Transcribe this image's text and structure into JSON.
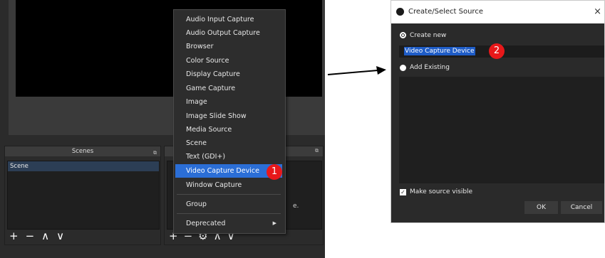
{
  "obs": {
    "scenes_dock": {
      "title": "Scenes",
      "float_icon": "⧉",
      "items": [
        "Scene"
      ],
      "tools": [
        "+",
        "−",
        "∧",
        "∨"
      ]
    },
    "sources_dock": {
      "float_icon": "⧉",
      "hint_fragment": "e.",
      "tools": [
        "+",
        "−",
        "⚙",
        "∧",
        "∨"
      ]
    }
  },
  "context_menu": {
    "items": [
      "Audio Input Capture",
      "Audio Output Capture",
      "Browser",
      "Color Source",
      "Display Capture",
      "Game Capture",
      "Image",
      "Image Slide Show",
      "Media Source",
      "Scene",
      "Text (GDI+)",
      "Video Capture Device",
      "Window Capture"
    ],
    "selected": "Video Capture Device",
    "group_label": "Group",
    "deprecated_label": "Deprecated",
    "submenu_arrow": "▶"
  },
  "badges": {
    "one": "1",
    "two": "2"
  },
  "dialog": {
    "title": "Create/Select Source",
    "close_glyph": "×",
    "create_new_label": "Create new",
    "name_value": "Video Capture Device",
    "add_existing_label": "Add Existing",
    "make_visible_label": "Make source visible",
    "make_visible_checked": true,
    "ok_label": "OK",
    "cancel_label": "Cancel"
  },
  "colors": {
    "menu_highlight": "#2b6ed6",
    "badge_red": "#e8181a",
    "text_selection": "#1e5cc7"
  }
}
